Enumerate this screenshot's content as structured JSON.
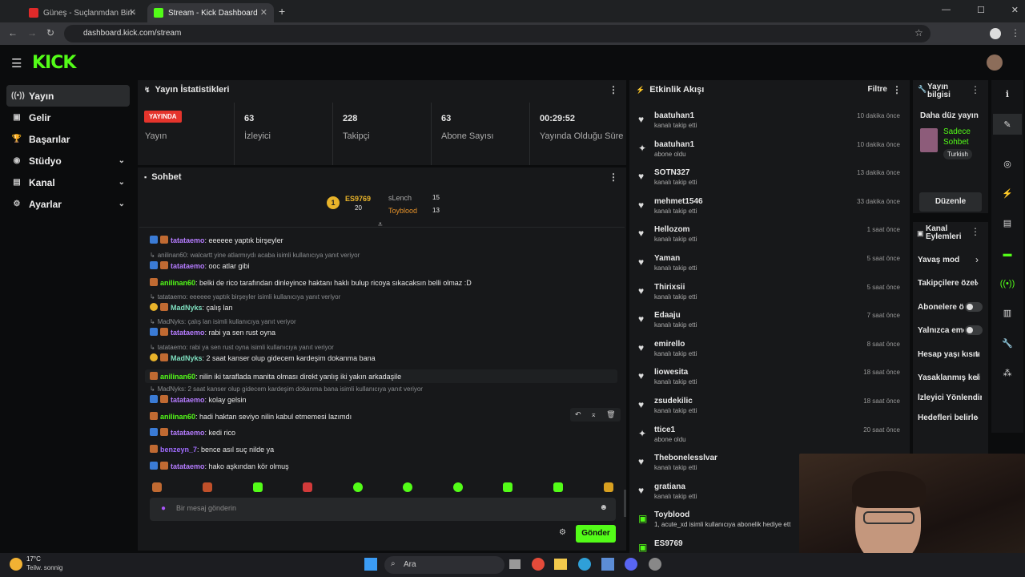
{
  "browser": {
    "tabs": [
      {
        "title": "Güneş - Suçlanmdan Biri (Offic"
      },
      {
        "title": "Stream - Kick Dashboard"
      }
    ],
    "url": "dashboard.kick.com/stream"
  },
  "sidebar": {
    "items": [
      {
        "label": "Yayın"
      },
      {
        "label": "Gelir"
      },
      {
        "label": "Başarılar"
      },
      {
        "label": "Stüdyo"
      },
      {
        "label": "Kanal"
      },
      {
        "label": "Ayarlar"
      }
    ]
  },
  "stats": {
    "title": "Yayın İstatistikleri",
    "live_badge": "YAYINDA",
    "live_label": "Yayın",
    "viewers": "63",
    "viewers_label": "İzleyici",
    "followers": "228",
    "followers_label": "Takipçi",
    "subs": "63",
    "subs_label": "Abone Sayısı",
    "uptime": "00:29:52",
    "uptime_label": "Yayında Olduğu Süre"
  },
  "chat": {
    "title": "Sohbet",
    "leaders": {
      "first": "ES9769",
      "first_count": "20",
      "second": "sLench",
      "second_count": "15",
      "third": "Toyblood",
      "third_count": "13"
    },
    "messages": [
      {
        "reply": "",
        "user": "tatataemo",
        "text": ": eeeeee yaptık birşeyler",
        "color": "#b57cff"
      },
      {
        "reply": "anilinan60: walcartt yine atlarmıydı acaba isimli kullanıcıya yanıt veriyor",
        "user": "tatataemo",
        "text": ": ooc atlar gibi",
        "color": "#b57cff"
      },
      {
        "reply": "",
        "user": "anilinan60",
        "text": ": belki de rico tarafından dinleyince haktanı haklı bulup ricoya sıkacaksın belli olmaz :D",
        "color": "#53fc18"
      },
      {
        "reply": "tatataemo: eeeeee yaptık birşeyler isimli kullanıcıya yanıt veriyor",
        "user": "MadNyks",
        "text": ": çalış lan",
        "color": "#7fe0c0"
      },
      {
        "reply": "MadNyks: çalış lan isimli kullanıcıya yanıt veriyor",
        "user": "tatataemo",
        "text": ": rabi ya sen rust oyna",
        "color": "#b57cff"
      },
      {
        "reply": "tatataemo: rabi ya sen rust oyna isimli kullanıcıya yanıt veriyor",
        "user": "MadNyks",
        "text": ": 2 saat kanser olup gidecem kardeşim dokanma bana",
        "color": "#7fe0c0"
      },
      {
        "reply": "",
        "user": "anilinan60",
        "text": ": nilin iki taraflada manita olması direkt yanlış iki yakın arkadaşile",
        "color": "#53fc18"
      },
      {
        "reply": "MadNyks: 2 saat kanser olup gidecem kardeşim dokanma bana isimli kullanıcıya yanıt veriyor",
        "user": "tatataemo",
        "text": ": kolay gelsin",
        "color": "#b57cff"
      },
      {
        "reply": "",
        "user": "anilinan60",
        "text": ": hadi haktan seviyo nilin kabul etmemesi lazımdı",
        "color": "#53fc18"
      },
      {
        "reply": "",
        "user": "tatataemo",
        "text": ": kedi rico",
        "color": "#b57cff"
      },
      {
        "reply": "",
        "user": "benzeyn_7",
        "text": ": bence asıl suç nilde ya",
        "color": "#a06cff"
      },
      {
        "reply": "",
        "user": "tatataemo",
        "text": ": hako aşkından kör olmuş",
        "color": "#b57cff"
      }
    ],
    "input_placeholder": "Bir mesaj gönderin",
    "send_label": "Gönder"
  },
  "events": {
    "title": "Etkinlik Akışı",
    "filter": "Filtre",
    "items": [
      {
        "name": "baatuhan1",
        "action": "kanalı takip etti",
        "time": "10 dakika önce",
        "icon": "heart-icon"
      },
      {
        "name": "baatuhan1",
        "action": "abone oldu",
        "time": "10 dakika önce",
        "icon": "sparkle-icon"
      },
      {
        "name": "SOTN327",
        "action": "kanalı takip etti",
        "time": "13 dakika önce",
        "icon": "heart-icon"
      },
      {
        "name": "mehmet1546",
        "action": "kanalı takip etti",
        "time": "33 dakika önce",
        "icon": "heart-icon"
      },
      {
        "name": "Hellozom",
        "action": "kanalı takip etti",
        "time": "1 saat önce",
        "icon": "heart-icon"
      },
      {
        "name": "Yaman",
        "action": "kanalı takip etti",
        "time": "5 saat önce",
        "icon": "heart-icon"
      },
      {
        "name": "Thirixsii",
        "action": "kanalı takip etti",
        "time": "5 saat önce",
        "icon": "heart-icon"
      },
      {
        "name": "Edaaju",
        "action": "kanalı takip etti",
        "time": "7 saat önce",
        "icon": "heart-icon"
      },
      {
        "name": "emirello",
        "action": "kanalı takip etti",
        "time": "8 saat önce",
        "icon": "heart-icon"
      },
      {
        "name": "liowesita",
        "action": "kanalı takip etti",
        "time": "18 saat önce",
        "icon": "heart-icon"
      },
      {
        "name": "zsudekilic",
        "action": "kanalı takip etti",
        "time": "18 saat önce",
        "icon": "heart-icon"
      },
      {
        "name": "ttice1",
        "action": "abone oldu",
        "time": "20 saat önce",
        "icon": "sparkle-icon"
      },
      {
        "name": "Thebonelesslvar",
        "action": "kanalı takip etti",
        "time": "",
        "icon": "heart-icon"
      },
      {
        "name": "gratiana",
        "action": "kanalı takip etti",
        "time": "",
        "icon": "heart-icon"
      },
      {
        "name": "Toyblood",
        "action": "1, acute_xd isimli kullanıcıya abonelik hediye ett",
        "time": "",
        "icon": "gift-icon"
      },
      {
        "name": "ES9769",
        "action": "",
        "time": "",
        "icon": "gift-icon"
      }
    ]
  },
  "info": {
    "title": "Yayın bilgisi",
    "stream_title": "Daha düz yayın",
    "category": "Sadece Sohbet",
    "language": "Turkish",
    "edit": "Düzenle"
  },
  "actions": {
    "title": "Kanal Eylemleri",
    "items": [
      {
        "label": "Yavaş mod"
      },
      {
        "label": "Takipçilere özel"
      },
      {
        "label": "Abonelere özel"
      },
      {
        "label": "Yalnızca emote"
      },
      {
        "label": "Hesap yaşı kısıtı"
      },
      {
        "label": "Yasaklanmış kelimeler"
      },
      {
        "label": "İzleyici Yönlendir"
      },
      {
        "label": "Hedefleri belirle"
      }
    ]
  },
  "taskbar": {
    "temp": "17°C",
    "weather": "Teilw. sonnig",
    "search": "Ara"
  },
  "colors": {
    "brand": "#53fc18",
    "live": "#e5342c"
  }
}
